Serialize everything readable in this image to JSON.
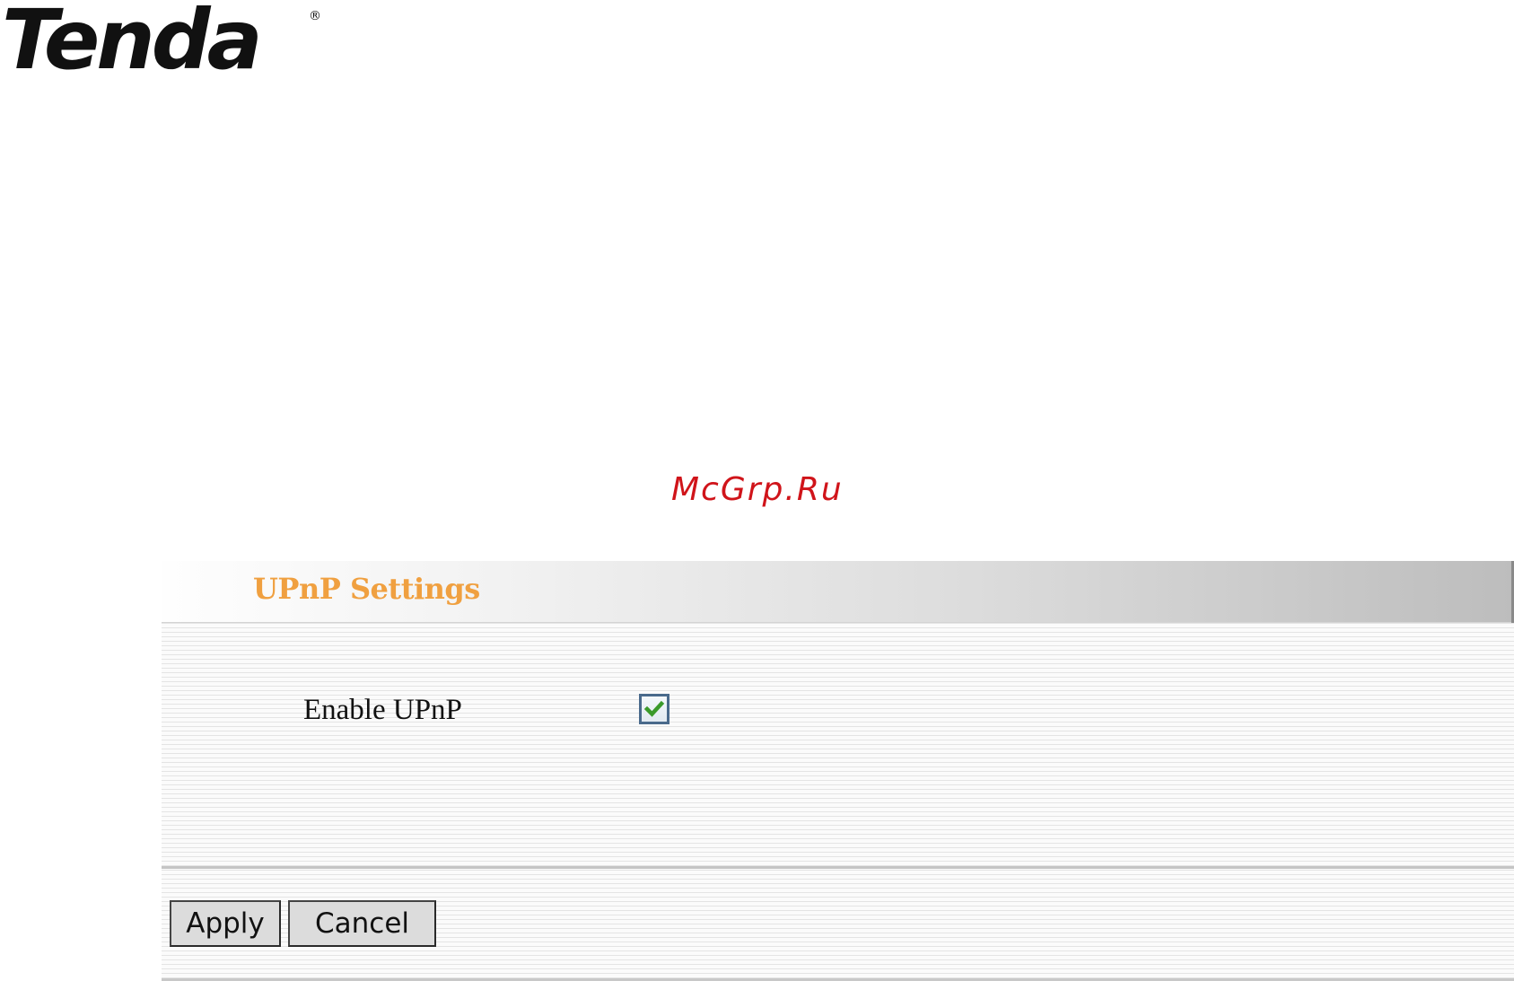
{
  "brand": {
    "logo_text": "Tenda",
    "registered_mark": "®"
  },
  "watermark": {
    "text": "McGrp.Ru"
  },
  "upnp_panel": {
    "title": "UPnP Settings",
    "enable_label": "Enable UPnP",
    "enable_checked": true
  },
  "buttons": {
    "apply_label": "Apply",
    "cancel_label": "Cancel"
  },
  "colors": {
    "title_orange": "#f0a040",
    "watermark_red": "#d0141a",
    "check_green": "#3a9a2a"
  }
}
